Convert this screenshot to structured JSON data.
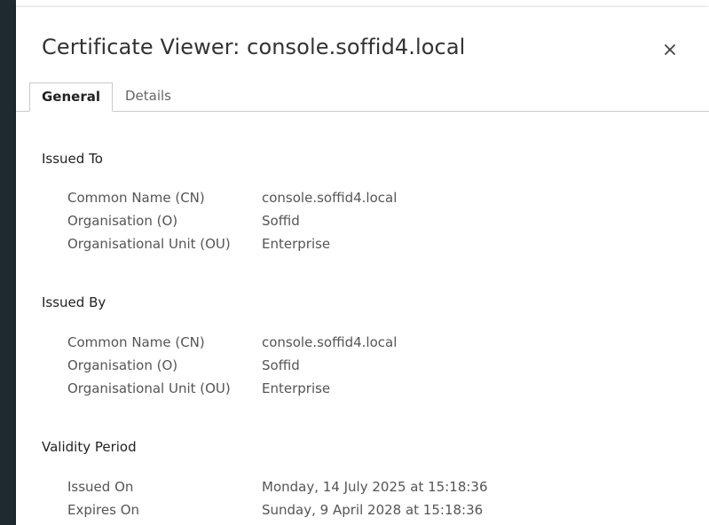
{
  "dialog": {
    "title": "Certificate Viewer: console.soffid4.local",
    "close_icon": "close-icon"
  },
  "tabs": [
    {
      "label": "General",
      "selected": true
    },
    {
      "label": "Details",
      "selected": false
    }
  ],
  "issued_to": {
    "heading": "Issued To",
    "fields": [
      {
        "label": "Common Name (CN)",
        "value": "console.soffid4.local"
      },
      {
        "label": "Organisation (O)",
        "value": "Soffid"
      },
      {
        "label": "Organisational Unit (OU)",
        "value": "Enterprise"
      }
    ]
  },
  "issued_by": {
    "heading": "Issued By",
    "fields": [
      {
        "label": "Common Name (CN)",
        "value": "console.soffid4.local"
      },
      {
        "label": "Organisation (O)",
        "value": "Soffid"
      },
      {
        "label": "Organisational Unit (OU)",
        "value": "Enterprise"
      }
    ]
  },
  "validity": {
    "heading": "Validity Period",
    "fields": [
      {
        "label": "Issued On",
        "value": "Monday, 14 July 2025 at 15:18:36"
      },
      {
        "label": "Expires On",
        "value": "Sunday, 9 April 2028 at 15:18:36"
      }
    ]
  },
  "colors": {
    "backdrop": "#1f2a30",
    "text_primary": "#222222",
    "text_secondary": "#555555",
    "divider": "#c9c9c9"
  }
}
